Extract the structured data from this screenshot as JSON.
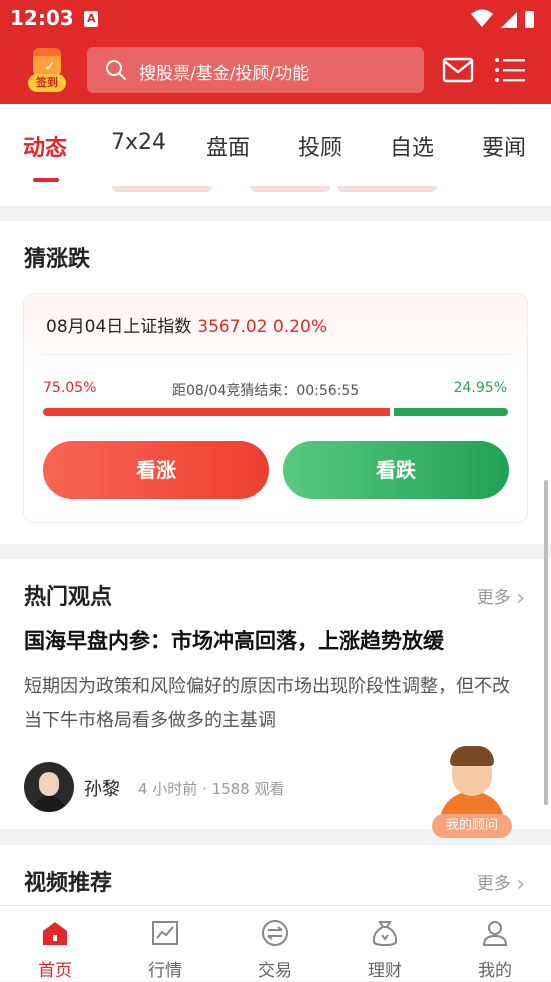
{
  "status_bar": {
    "time": "12:03",
    "notif_letter": "A"
  },
  "header": {
    "sign_label": "签到",
    "search_placeholder": "搜股票/基金/投顾/功能",
    "accent_color": "#e02a2a"
  },
  "tabs": [
    {
      "label": "动态",
      "active": true
    },
    {
      "label": "7x24"
    },
    {
      "label": "盘面"
    },
    {
      "label": "投顾"
    },
    {
      "label": "自选"
    },
    {
      "label": "要闻"
    }
  ],
  "guess": {
    "title": "猜涨跌",
    "date_index": "08月04日上证指数",
    "index_value": "3567.02 0.20%",
    "rise_pct": "75.05%",
    "fall_pct": "24.95%",
    "countdown": "距08/04竞猜结束：00:56:55",
    "rise_fraction": 0.7505,
    "rise_button": "看涨",
    "fall_button": "看跌"
  },
  "hot": {
    "title": "热门观点",
    "more": "更多",
    "headline": "国海早盘内参：市场冲高回落，上涨趋势放缓",
    "summary": "短期因为政策和风险偏好的原因市场出现阶段性调整，但不改当下牛市格局看多做多的主基调",
    "author": "孙黎",
    "meta": "4 小时前 · 1588 观看",
    "advisor_label": "我的顾问"
  },
  "video": {
    "title": "视频推荐",
    "more": "更多"
  },
  "bottom_nav": [
    {
      "label": "首页",
      "icon": "home-icon",
      "active": true
    },
    {
      "label": "行情",
      "icon": "chart-icon"
    },
    {
      "label": "交易",
      "icon": "exchange-icon"
    },
    {
      "label": "理财",
      "icon": "money-bag-icon"
    },
    {
      "label": "我的",
      "icon": "person-icon"
    }
  ]
}
